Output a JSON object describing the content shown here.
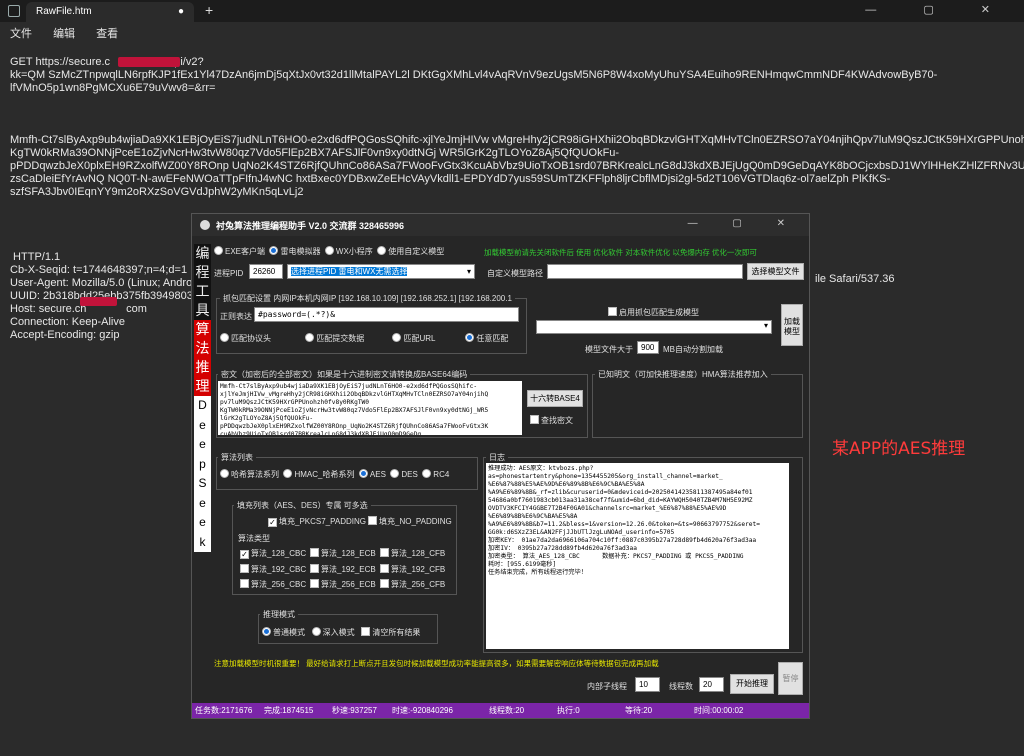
{
  "notepad": {
    "tab_title": "RawFile.htm",
    "tab_dot": "●",
    "new_tab": "+",
    "menu": [
      "文件",
      "编辑",
      "查看"
    ],
    "window_controls": "—  ▢  ✕",
    "lines": [
      "GET https://secure.c                  /api/v2?",
      "kk=QM SzMcZTnpwqlLN6rpfKJP1fEx1Yl47DzAn6jmDj5qXtJx0vt32d1llMtalPAYL2l DKtGgXMhLvl4vAqRVnV9ezUgsM5N6P8W4xoMyUhuYSA4Euiho9RENHmqwCmmNDF4KWAdvowByB70-",
      "lfVMnO5p1wn8PgMCXu6E79uVwv8=&rr=",
      "",
      "",
      "",
      "Mmfh-Ct7slByAxp9ub4wjiaDa9XK1EBjOyEiS7judNLnT6HO0-e2xd6dfPQGosSQhifc-xjlYeJmjHIVw vMgreHhy2jCR98iGHXhii2ObqBDkzvlGHTXqMHvTCln0EZRSO7aY04njihQpv7luM9QszJCtK59HXrGPPUnohzh0fv8y0R",
      "KgTW0kRMa39ONNjPceE1oZjvNcrHw3tvW80qz7Vdo5FlEp2BX7AFSJlF0vn9xy0dtNGj WR5lGrK2gTLOYoZ8Aj5QfQUOkFu-",
      "pPDDqwzbJeX0plxEH9RZxolfWZ00Y8ROnp UqNo2K4STZ6RjfQUhnCo86ASa7FWooFvGtx3KcuAbVbz9UioTxOB1srd07BRKrealcLnG8dJ3kdXBJEjUgQ0mD9GeDqAYK8bOCjcxbsDJ1WYlHHeKZHlZFRNv3UW9TWWgFv",
      "zsCaDleiEfYrAvNQ NQ0T-N-awEFeNWOaTTpFIfnJ4wNC hxtBxec0YDBxwZeEHcVAyVkdll1-EPDYdD7yus59SUmTZKFFlph8ljrCbflMDjsi2gl-5d2T106VGTDlaq6z-ol7aelZph PlKfKS-",
      "szfSFA3Jbv0IEqnYY9m2oRXzSoVGVdJphW2yMKn5qLvLj2",
      "",
      "",
      "",
      "",
      " HTTP/1.1",
      "Cb-X-Seqid: t=1744648397;n=4;d=1",
      "User-Agent: Mozilla/5.0 (Linux; Androi",
      "UUID: 2b318bdd25ebb375fb3949803",
      "Host: secure.ch             com",
      "Connection: Keep-Alive",
      "Accept-Encoding: gzip"
    ],
    "ua_tail": "ile Safari/537.36"
  },
  "tool": {
    "title": "衬兔算法推理编程助手 V2.0  交流群  328465996",
    "window_controls": "—  ▢  ✕",
    "side_top": [
      "编",
      "程",
      "工",
      "具"
    ],
    "side_red": [
      "算",
      "法",
      "推",
      "理"
    ],
    "side_white": [
      "D",
      "e",
      "e",
      "p",
      "S",
      "e",
      "e",
      "k"
    ],
    "target_radios": [
      "EXE客户端",
      "雷电模拟器",
      "WX小程序",
      "使用自定义模型"
    ],
    "green_hint": "加载模型前请先关闭软件后 使用 优化软件 对本软件优化 以免爆内存 优化一次即可",
    "pid_label": "进程PID",
    "pid_value": "26260",
    "pid_select": "选择进程PID 雷电和WX无需选择",
    "custom_model_label": "自定义模型路径",
    "select_model_btn": "选择模型文件",
    "packet_group": "抓包匹配设置 内网IP本机内网IP [192.168.10.109] [192.168.252.1] [192.168.200.1",
    "regex_label": "正则表达",
    "regex_value": "#password=(.*?)&",
    "match_radios": [
      "匹配协议头",
      "匹配提交数据",
      "匹配URL",
      "任意匹配"
    ],
    "enable_model_chk": "启用抓包匹配生成模型",
    "load_model_btn": "加载模型",
    "model_size_label": "模型文件大于",
    "model_size_value": "900",
    "model_size_unit": "MB自动分割加载",
    "cipher_label": "密文（加密后的全部密文）如果是十六进制密文请转换成BASE64编码",
    "cipher_text": "Mmfh-Ct7slByAxp9ub4wjiaDa9XK1EBjOyEiS7judNLnT6HO0-e2xd6dfPQGosSQhifc-\nxjlYeJmjHIVw_vMgreHhy2jCR98iGHXhii2ObqBDkzvlGHTXqMHvTCln0EZRSO7aY04njihQ\npv7luM9QszJCtK59HXrGPPUnohzh0fv8y0RKgTW0\nKgTW0kRMa39ONNjPceE1oZjvNcrHw3tvW80qz7Vdo5FlEp2BX7AFSJlF0vn9xy0dtNGj_WR5\nlGrK2gTLOYoZ8Aj5QfQUOkFu-\npPDDqwzbJeX0plxEH9RZxolfWZ00Y8ROnp_UqNo2K4STZ6RjfQUhnCo86ASa7FWooFvGtx3K\ncuAbVbz9UioTxOB1srd07BRKrealcLnG8dJ3kdXBJEjUgQ0mD9GeDq",
    "hex_btn": "十六转BASE4",
    "find_chk": "查找密文",
    "plain_label": "已知明文（可加快推理速度）HMA算法推荐加入",
    "annotation": "某APP的AES推理",
    "algo_group": "算法列表",
    "algo_radios": [
      "哈希算法系列",
      "HMAC_哈希系列",
      "AES",
      "DES",
      "RC4"
    ],
    "padding_group": "填充列表（AES、DES）专属 可多选",
    "padding_opts": [
      "填充_PKCS7_PADDING",
      "填充_NO_PADDING"
    ],
    "algo_type_label": "算法类型",
    "algo_types": [
      [
        "算法_128_CBC",
        "算法_128_ECB",
        "算法_128_CFB"
      ],
      [
        "算法_192_CBC",
        "算法_192_ECB",
        "算法_192_CFB"
      ],
      [
        "算法_256_CBC",
        "算法_256_ECB",
        "算法_256_CFB"
      ]
    ],
    "mode_group": "推理模式",
    "mode_radios": [
      "普通模式",
      "深入模式"
    ],
    "clear_chk": "清空所有结果",
    "log_group": "日志",
    "log_text": "推理成功：AES原文：ktvbozs.php?\nas=phonestartentry&phone=1354455205&org_install_channel=market_\n%E6%87%88%E5%AE%9D%E6%89%8B%E6%9C%BA%E5%8A\n%A9%E6%89%8B&_rf=zlib&curuserid=0&mdeviceid=20250414235811387495a84ef01\n54686a0bf7601983cb013aa31a38cef7f&umid=6bd_did=KAYWQH5040TZB4M7NH5E92MZ\nOVDTV3KFCIY4GGBE7T2B4F0GA01&channelsrc=market_%E6%87%88%E5%AE%9D\n%E6%89%8B%E6%9C%BA%E5%8A\n%A9%E6%89%8B&b7=11.2&bless=1&version=12.26.0&token=&ts=90663797752&seret=\nGG0k:d6SXzZ3EL&AN2FFjJJbUTlJzgLuNOAd_userinfo=5705\n加密KEY： 01ae7da2da6966106a704c10ff:0887c0395b27a728d89fb4d620a76f3ad3aa\n加密IV： 0395b27a728dd89fb4d620a76f3ad3aa\n加密类型： 算法_AES_128_CBC      数据补充：PKCS7_PADDING 或 PKCS5_PADDING\n耗时：[955.6199毫秒]\n任务结束完成，所有线程运行完毕！",
    "yellow_hint": "注意加载模型时机很重要！ 最好给请求打上断点开且发包时候加载模型成功率能提高很多，如果需要解密响应体等待数据包完成再加载",
    "inner_threads_label": "内部子线程",
    "inner_threads_value": "10",
    "threads_label": "线程数",
    "threads_value": "20",
    "start_btn": "开始推理",
    "pause_btn": "暂停",
    "status": {
      "tasks": "任务数:2171676",
      "done": "完成:1874515",
      "speed": "秒速:937257",
      "time": "时速:-920840296",
      "thread_count": "线程数:20",
      "exec": "执行:0",
      "wait": "等待:20",
      "elapsed": "时间:00:00:02"
    }
  }
}
